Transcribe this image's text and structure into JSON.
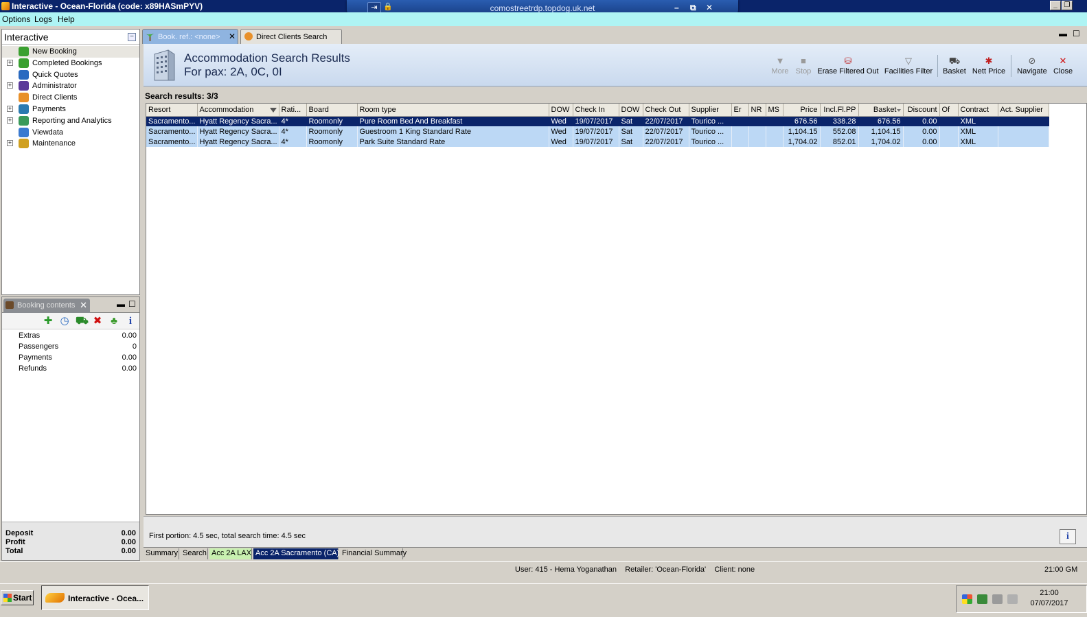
{
  "window": {
    "title": "Interactive - Ocean-Florida (code: x89HASmPYV)",
    "remote_host": "comostreetrdp.topdog.uk.net"
  },
  "menu": [
    "Options",
    "Logs",
    "Help"
  ],
  "nav": {
    "title": "Interactive",
    "items": [
      {
        "label": "New Booking",
        "icon": "palm-tree-icon",
        "expandable": false,
        "selected": true
      },
      {
        "label": "Completed Bookings",
        "icon": "palm-tree-icon",
        "expandable": true
      },
      {
        "label": "Quick Quotes",
        "icon": "clock-icon",
        "expandable": false
      },
      {
        "label": "Administrator",
        "icon": "person-icon",
        "expandable": true
      },
      {
        "label": "Direct Clients",
        "icon": "clients-icon",
        "expandable": false
      },
      {
        "label": "Payments",
        "icon": "payments-icon",
        "expandable": true
      },
      {
        "label": "Reporting and Analytics",
        "icon": "report-icon",
        "expandable": true
      },
      {
        "label": "Viewdata",
        "icon": "globe-icon",
        "expandable": false
      },
      {
        "label": "Maintenance",
        "icon": "books-icon",
        "expandable": true
      }
    ]
  },
  "booking_contents": {
    "tab_label": "Booking contents",
    "rows": [
      {
        "label": "Extras",
        "value": "0.00"
      },
      {
        "label": "Passengers",
        "value": "0"
      },
      {
        "label": "Payments",
        "value": "0.00"
      },
      {
        "label": "Refunds",
        "value": "0.00"
      }
    ],
    "footer": [
      {
        "label": "Deposit",
        "value": "0.00"
      },
      {
        "label": "Profit",
        "value": "0.00"
      },
      {
        "label": "Total",
        "value": "0.00"
      }
    ]
  },
  "doc_tabs": [
    {
      "label": "Book. ref.: <none>",
      "active": true
    },
    {
      "label": "Direct Clients Search",
      "active": false
    }
  ],
  "header": {
    "title": "Accommodation Search Results",
    "subtitle": "For pax: 2A, 0C, 0I"
  },
  "toolbar": {
    "more": "More",
    "stop": "Stop",
    "erase": "Erase Filtered Out",
    "facilities": "Facilities Filter",
    "basket": "Basket",
    "nett": "Nett Price",
    "navigate": "Navigate",
    "close": "Close"
  },
  "results_label": "Search results: 3/3",
  "grid": {
    "columns": [
      "Resort",
      "Accommodation",
      "Rati...",
      "Board",
      "Room type",
      "DOW",
      "Check In",
      "DOW",
      "Check Out",
      "Supplier",
      "Er",
      "NR",
      "MS",
      "Price",
      "Incl.Fl.PP",
      "Basket",
      "Discount",
      "Of",
      "Contract",
      "Act. Supplier"
    ],
    "rows": [
      [
        "Sacramento...",
        "Hyatt Regency Sacra...",
        "4*",
        "Roomonly",
        "Pure Room Bed And Breakfast",
        "Wed",
        "19/07/2017",
        "Sat",
        "22/07/2017",
        "Tourico ...",
        "",
        "",
        "",
        "676.56",
        "338.28",
        "676.56",
        "0.00",
        "",
        "XML",
        ""
      ],
      [
        "Sacramento...",
        "Hyatt Regency Sacra...",
        "4*",
        "Roomonly",
        "Guestroom 1 King Standard Rate",
        "Wed",
        "19/07/2017",
        "Sat",
        "22/07/2017",
        "Tourico ...",
        "",
        "",
        "",
        "1,104.15",
        "552.08",
        "1,104.15",
        "0.00",
        "",
        "XML",
        ""
      ],
      [
        "Sacramento...",
        "Hyatt Regency Sacra...",
        "4*",
        "Roomonly",
        "Park Suite Standard Rate",
        "Wed",
        "19/07/2017",
        "Sat",
        "22/07/2017",
        "Tourico ...",
        "",
        "",
        "",
        "1,704.02",
        "852.01",
        "1,704.02",
        "0.00",
        "",
        "XML",
        ""
      ]
    ]
  },
  "search_time": "First portion: 4.5 sec, total search time: 4.5 sec",
  "bottom_tabs": [
    {
      "label": "Summary",
      "style": "plain"
    },
    {
      "label": "Search",
      "style": "plain"
    },
    {
      "label": "Acc 2A LAX",
      "style": "green"
    },
    {
      "label": "Acc 2A Sacramento (CA)",
      "style": "active"
    },
    {
      "label": "Financial Summary",
      "style": "plain"
    }
  ],
  "status": {
    "user": "User: 415 - Hema Yoganathan",
    "retailer": "Retailer: 'Ocean-Florida'",
    "client": "Client: none",
    "time": "21:00 GM"
  },
  "taskbar": {
    "start": "Start",
    "app": "Interactive - Ocea...",
    "clock_time": "21:00",
    "clock_date": "07/07/2017"
  },
  "colors": {
    "title_bar": "#0a246a",
    "menu_bar": "#aef4f4",
    "row_bg": "#bcd8f5",
    "row_selected": "#0a246a",
    "close_red": "#d01010"
  }
}
